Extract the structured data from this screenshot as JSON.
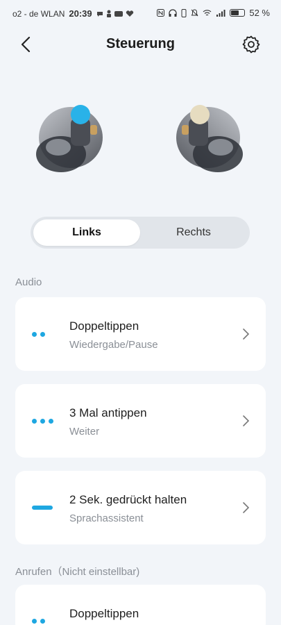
{
  "status_bar": {
    "carrier": "o2 - de WLAN",
    "time": "20:39",
    "battery": "52 %",
    "battery_level": 0.52
  },
  "header": {
    "title": "Steuerung",
    "back_icon": "chevron-left-icon",
    "settings_icon": "gear-icon"
  },
  "colors": {
    "accent": "#1ea7e1",
    "background": "#f2f5f9",
    "card": "#ffffff"
  },
  "tabs": {
    "left": "Links",
    "right": "Rechts",
    "selected": "Links"
  },
  "sections": {
    "audio": "Audio",
    "calls": "Anrufen（Nicht einstellbar)"
  },
  "audio_items": [
    {
      "title": "Doppeltippen",
      "subtitle": "Wiedergabe/Pause",
      "gesture": "2-dots"
    },
    {
      "title": "3 Mal antippen",
      "subtitle": "Weiter",
      "gesture": "3-dots"
    },
    {
      "title": "2 Sek. gedrückt halten",
      "subtitle": "Sprachassistent",
      "gesture": "long-press-bar"
    }
  ],
  "call_items": [
    {
      "title": "Doppeltippen",
      "gesture": "2-dots"
    }
  ]
}
